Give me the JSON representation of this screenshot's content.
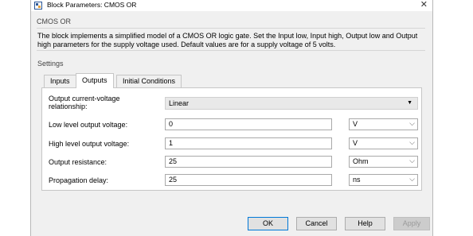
{
  "window": {
    "title": "Block Parameters: CMOS OR",
    "close_glyph": "✕"
  },
  "block": {
    "name": "CMOS OR",
    "description": "The block implements a simplified model of a CMOS OR logic gate. Set the Input low, Input high, Output low and Output high parameters for the supply voltage used. Default values are for a supply voltage of 5 volts."
  },
  "settings_label": "Settings",
  "tabs": [
    {
      "label": "Inputs",
      "active": false
    },
    {
      "label": "Outputs",
      "active": true
    },
    {
      "label": "Initial Conditions",
      "active": false
    }
  ],
  "params": {
    "relationship": {
      "label": "Output current-voltage relationship:",
      "value": "Linear"
    },
    "low_voltage": {
      "label": "Low level output voltage:",
      "value": "0",
      "unit": "V"
    },
    "high_voltage": {
      "label": "High level output voltage:",
      "value": "1",
      "unit": "V"
    },
    "resistance": {
      "label": "Output resistance:",
      "value": "25",
      "unit": "Ohm"
    },
    "delay": {
      "label": "Propagation delay:",
      "value": "25",
      "unit": "ns"
    }
  },
  "buttons": {
    "ok": "OK",
    "cancel": "Cancel",
    "help": "Help",
    "apply": "Apply"
  },
  "icons": {
    "app": "simulink-block-icon",
    "dropdown": "▼",
    "chevron": "⌵"
  },
  "colors": {
    "dialog_bg": "#f0f0f0",
    "default_button_border": "#0078d7"
  }
}
